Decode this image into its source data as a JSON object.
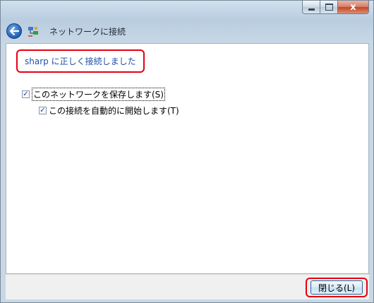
{
  "window": {
    "title": "ネットワークに接続",
    "caption_buttons": [
      "minimize",
      "maximize",
      "close"
    ],
    "close_glyph": "x"
  },
  "header": {
    "back_icon": "back-arrow-icon",
    "network_icon": "network-connect-icon"
  },
  "content": {
    "headline": "sharp に正しく接続しました",
    "checkboxes": [
      {
        "label": "このネットワークを保存します(S)",
        "checked": true
      },
      {
        "label": "この接続を自動的に開始します(T)",
        "checked": true
      }
    ]
  },
  "footer": {
    "close_button_label": "閉じる(L)"
  },
  "colors": {
    "highlight": "#e60012",
    "headline_text": "#1f4fa8"
  }
}
